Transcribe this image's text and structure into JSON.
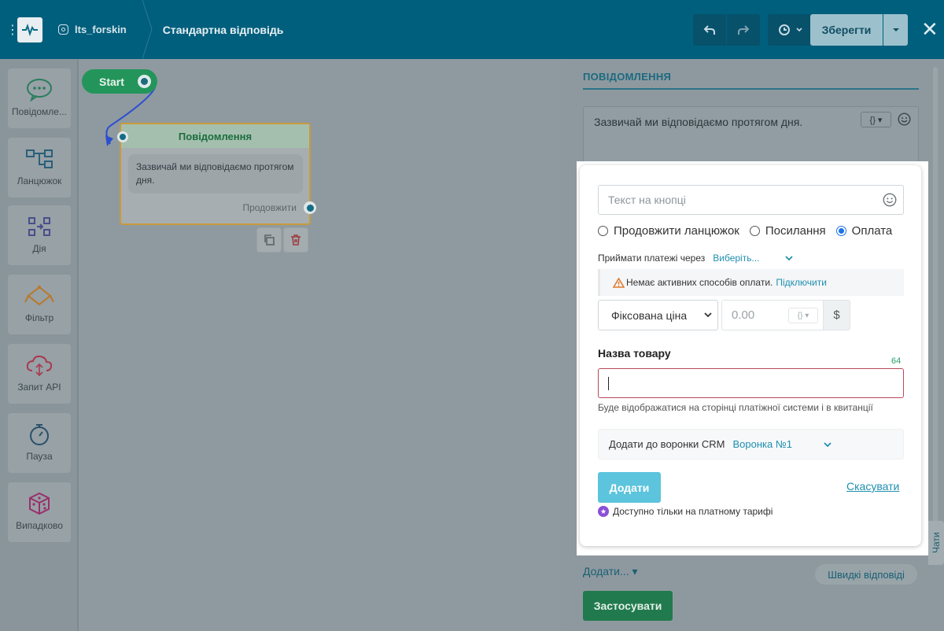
{
  "header": {
    "account": "lts_forskin",
    "breadcrumb": "Стандартна відповідь",
    "save_label": "Зберегти"
  },
  "palette": [
    {
      "label": "Повідомле...",
      "icon": "chat-bubble-icon"
    },
    {
      "label": "Ланцюжок",
      "icon": "chain-icon"
    },
    {
      "label": "Дія",
      "icon": "action-icon"
    },
    {
      "label": "Фільтр",
      "icon": "filter-icon"
    },
    {
      "label": "Запит API",
      "icon": "cloud-api-icon"
    },
    {
      "label": "Пауза",
      "icon": "stopwatch-icon"
    },
    {
      "label": "Випадково",
      "icon": "dice-icon"
    }
  ],
  "canvas": {
    "start_label": "Start",
    "node": {
      "title": "Повідомлення",
      "message": "Зазвичай ми відповідаємо протягом дня.",
      "continue_label": "Продовжити"
    }
  },
  "panel": {
    "title": "ПОВІДОМЛЕННЯ",
    "message_text": "Зазвичай ми відповідаємо протягом дня.",
    "add_menu": "Додати...",
    "quick_replies": "Швидкі відповіді",
    "apply": "Застосувати",
    "chats_tab": "Чати"
  },
  "popup": {
    "button_text_placeholder": "Текст на кнопці",
    "radios": [
      {
        "label": "Продовжити ланцюжок",
        "selected": false
      },
      {
        "label": "Посилання",
        "selected": false
      },
      {
        "label": "Оплата",
        "selected": true
      }
    ],
    "accept_payments_label": "Приймати платежі через",
    "accept_payments_value": "Виберіть...",
    "warning_text": "Немає активних способів оплати.",
    "warning_link": "Підключити",
    "price_type": "Фіксована ціна",
    "price_placeholder": "0.00",
    "currency": "$",
    "product_name_label": "Назва товару",
    "product_name_counter": "64",
    "product_name_value": "",
    "product_name_hint": "Буде відображатися на сторінці платіжної системи і в квитанції",
    "crm_label": "Додати до воронки CRM",
    "crm_value": "Воронка №1",
    "add_button": "Додати",
    "cancel": "Скасувати",
    "paid_only": "Доступно тільки на платному тарифі"
  }
}
